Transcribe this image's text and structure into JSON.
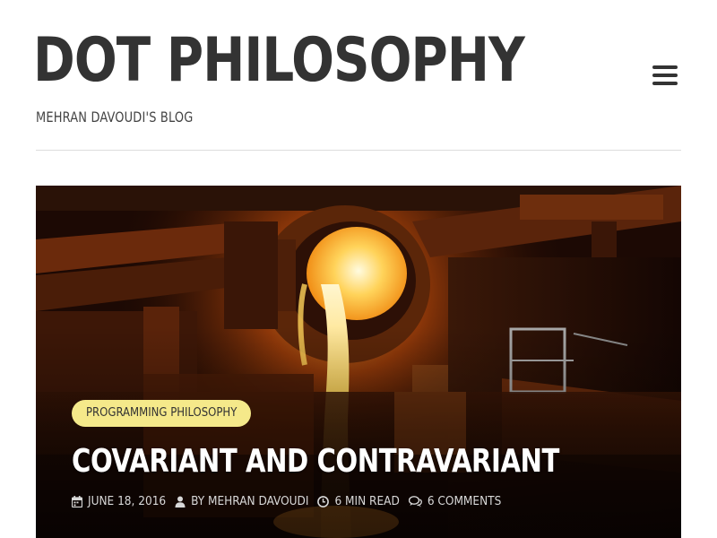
{
  "header": {
    "site_title": "DOT PHILOSOPHY",
    "tagline": "MEHRAN DAVOUDI'S BLOG",
    "menu_icon": "hamburger-menu-icon"
  },
  "featured_post": {
    "image_description": "molten metal pouring from a ladle in a steel foundry",
    "category": "PROGRAMMING PHILOSOPHY",
    "title": "COVARIANT AND CONTRAVARIANT",
    "meta": {
      "date_icon": "calendar-icon",
      "date": "JUNE 18, 2016",
      "author_icon": "user-icon",
      "author": "BY MEHRAN DAVOUDI",
      "read_time_icon": "clock-icon",
      "read_time": "6 MIN READ",
      "comments_icon": "comments-icon",
      "comments": "6 COMMENTS"
    }
  },
  "colors": {
    "text_dark": "#333333",
    "badge_background": "#f5e98a",
    "title_on_image": "#ffffff",
    "meta_on_image": "#d8d8d8",
    "divider": "#dddddd"
  }
}
